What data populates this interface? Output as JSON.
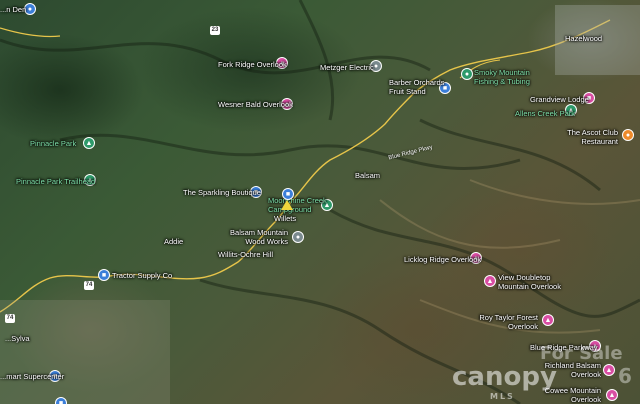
{
  "labels": {
    "raven_den": "...n Den",
    "fork_ridge": "Fork Ridge Overlook",
    "metzger": "Metzger Electric",
    "barber_orchards": "Barber Orchards Fruit Stand",
    "smoky_mountain": "Smoky Mountain Fishing & Tubing",
    "grandview_lodge": "Grandview Lodge",
    "allens_creek": "Allens Creek Park",
    "ascot_club": "The Ascot Club Restaurant",
    "wesner_bald": "Wesner Bald Overlook",
    "pinnacle_park": "Pinnacle Park",
    "pinnacle_trailhead": "Pinnacle Park Trailhead",
    "sparkling_boutique": "The Sparkling Boutique",
    "moonshine_creek": "Moonshine Creek Campground",
    "balsam": "Balsam",
    "willets": "Willets",
    "balsam_woodworks": "Balsam Mountain Wood Works",
    "addie": "Addie",
    "willits_ochre": "Willits-Ochre Hill",
    "tractor_supply": "Tractor Supply Co",
    "sylva": "...Sylva",
    "supercenter": "...mart Supercenter",
    "licklog": "Licklog Ridge Overlook",
    "doubletop": "View Doubletop Mountain Overlook",
    "roy_taylor": "Roy Taylor Forest Overlook",
    "blue_ridge_road": "Blue Ridge Pkwy",
    "blue_ridge_parking": "Blue Ridge Parkway",
    "richland_balsam": "Richland Balsam Overlook",
    "cowee": "Cowee Mountain Overlook",
    "hazelwood": "Hazelwood",
    "route_74": "74",
    "route_23": "23"
  },
  "watermark": {
    "brand": "canopy",
    "sub": "MLS",
    "for_sale": "For Sale",
    "number": "6"
  },
  "colors": {
    "poi_pink": "#d94ea3",
    "poi_green": "#2e9a6a",
    "poi_blue": "#3c7fd9",
    "road_yellow": "#e6c44a"
  }
}
